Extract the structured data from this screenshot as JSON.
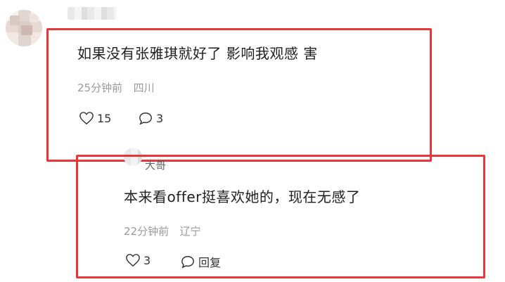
{
  "comment1": {
    "text": "如果没有张雅琪就好了 影响我观感 害",
    "time": "25分钟前",
    "location": "四川",
    "likes": "15",
    "replies": "3"
  },
  "comment2": {
    "partial_name": "大哥",
    "text": "本来看offer挺喜欢她的，现在无感了",
    "time": "22分钟前",
    "location": "辽宁",
    "likes": "3",
    "reply_label": "回复"
  },
  "colors": {
    "highlight": "#e8363a",
    "meta_text": "#9a9a9a"
  },
  "icons": [
    "heart-icon",
    "comment-bubble-icon"
  ]
}
